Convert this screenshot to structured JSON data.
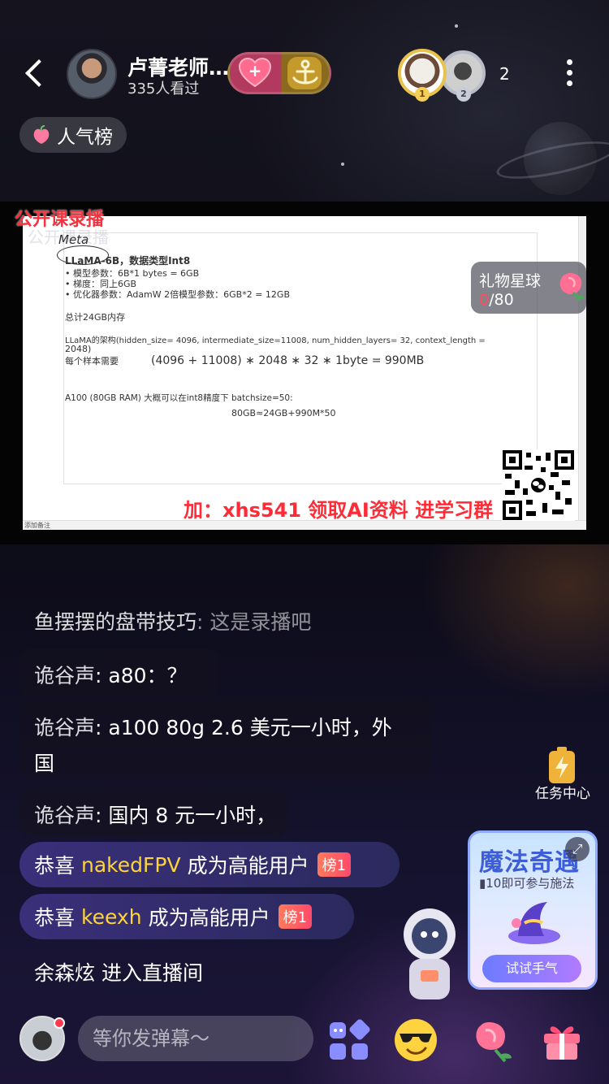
{
  "header": {
    "host_name": "卢菁老师…",
    "viewers": "335人看过",
    "online_count": "2",
    "hot_rank_label": "人气榜",
    "rank_badges": [
      "1",
      "2"
    ]
  },
  "video": {
    "recording_label": "公开课录播",
    "promo_text": "加：xhs541 领取AI资料 进学习群",
    "slide": {
      "handwriting": "Meta",
      "title_line": "LLaMA-6B，数据类型Int8",
      "bullets": [
        "模型参数：6B*1 bytes = 6GB",
        "梯度：同上6GB",
        "优化器参数：AdamW 2倍模型参数：6GB*2 = 12GB"
      ],
      "total": "总计24GB内存",
      "arch_line_1": "LLaMA的架构(hidden_size= 4096, intermediate_size=11008, num_hidden_layers= 32, context_length =",
      "arch_line_2": "2048)",
      "per_sample_label": "每个样本需要",
      "formula": "(4096 + 11008) ∗ 2048 ∗ 32 ∗ 1byte = 990MB",
      "a100_line": "A100 (80GB RAM) 大概可以在int8精度下 batchsize=50:",
      "a100_calc": "80GB≈24GB+990M*50",
      "footer_label": "添加备注"
    }
  },
  "gift_planet": {
    "title": "礼物星球",
    "progress_current": "0",
    "progress_total": "/80"
  },
  "chat": [
    {
      "user": "鱼摆摆的盘带技巧",
      "text": ": 这是录播吧"
    },
    {
      "user": "诡谷声",
      "text": ": a80：？"
    },
    {
      "user": "诡谷声",
      "text": ": a100 80g 2.6 美元一小时，外"
    },
    {
      "user": "",
      "text": "国"
    },
    {
      "user": "诡谷声",
      "text": ": 国内 8 元一小时，"
    }
  ],
  "congrats": [
    {
      "prefix": "恭喜",
      "name": "nakedFPV",
      "suffix": "成为高能用户",
      "tag": "榜1"
    },
    {
      "prefix": "恭喜",
      "name": "keexh",
      "suffix": "成为高能用户",
      "tag": "榜1"
    }
  ],
  "enter_message": "余森炫 进入直播间",
  "task_center": {
    "label": "任务中心"
  },
  "magic_card": {
    "title": "魔法奇遇",
    "subtitle": "10即可参与施法",
    "button": "试试手气"
  },
  "input": {
    "placeholder": "等你发弹幕～"
  },
  "colors": {
    "accent_red": "#ff2b36",
    "congrats_name": "#ffd43b",
    "progress_zero": "#ff4d5e"
  }
}
